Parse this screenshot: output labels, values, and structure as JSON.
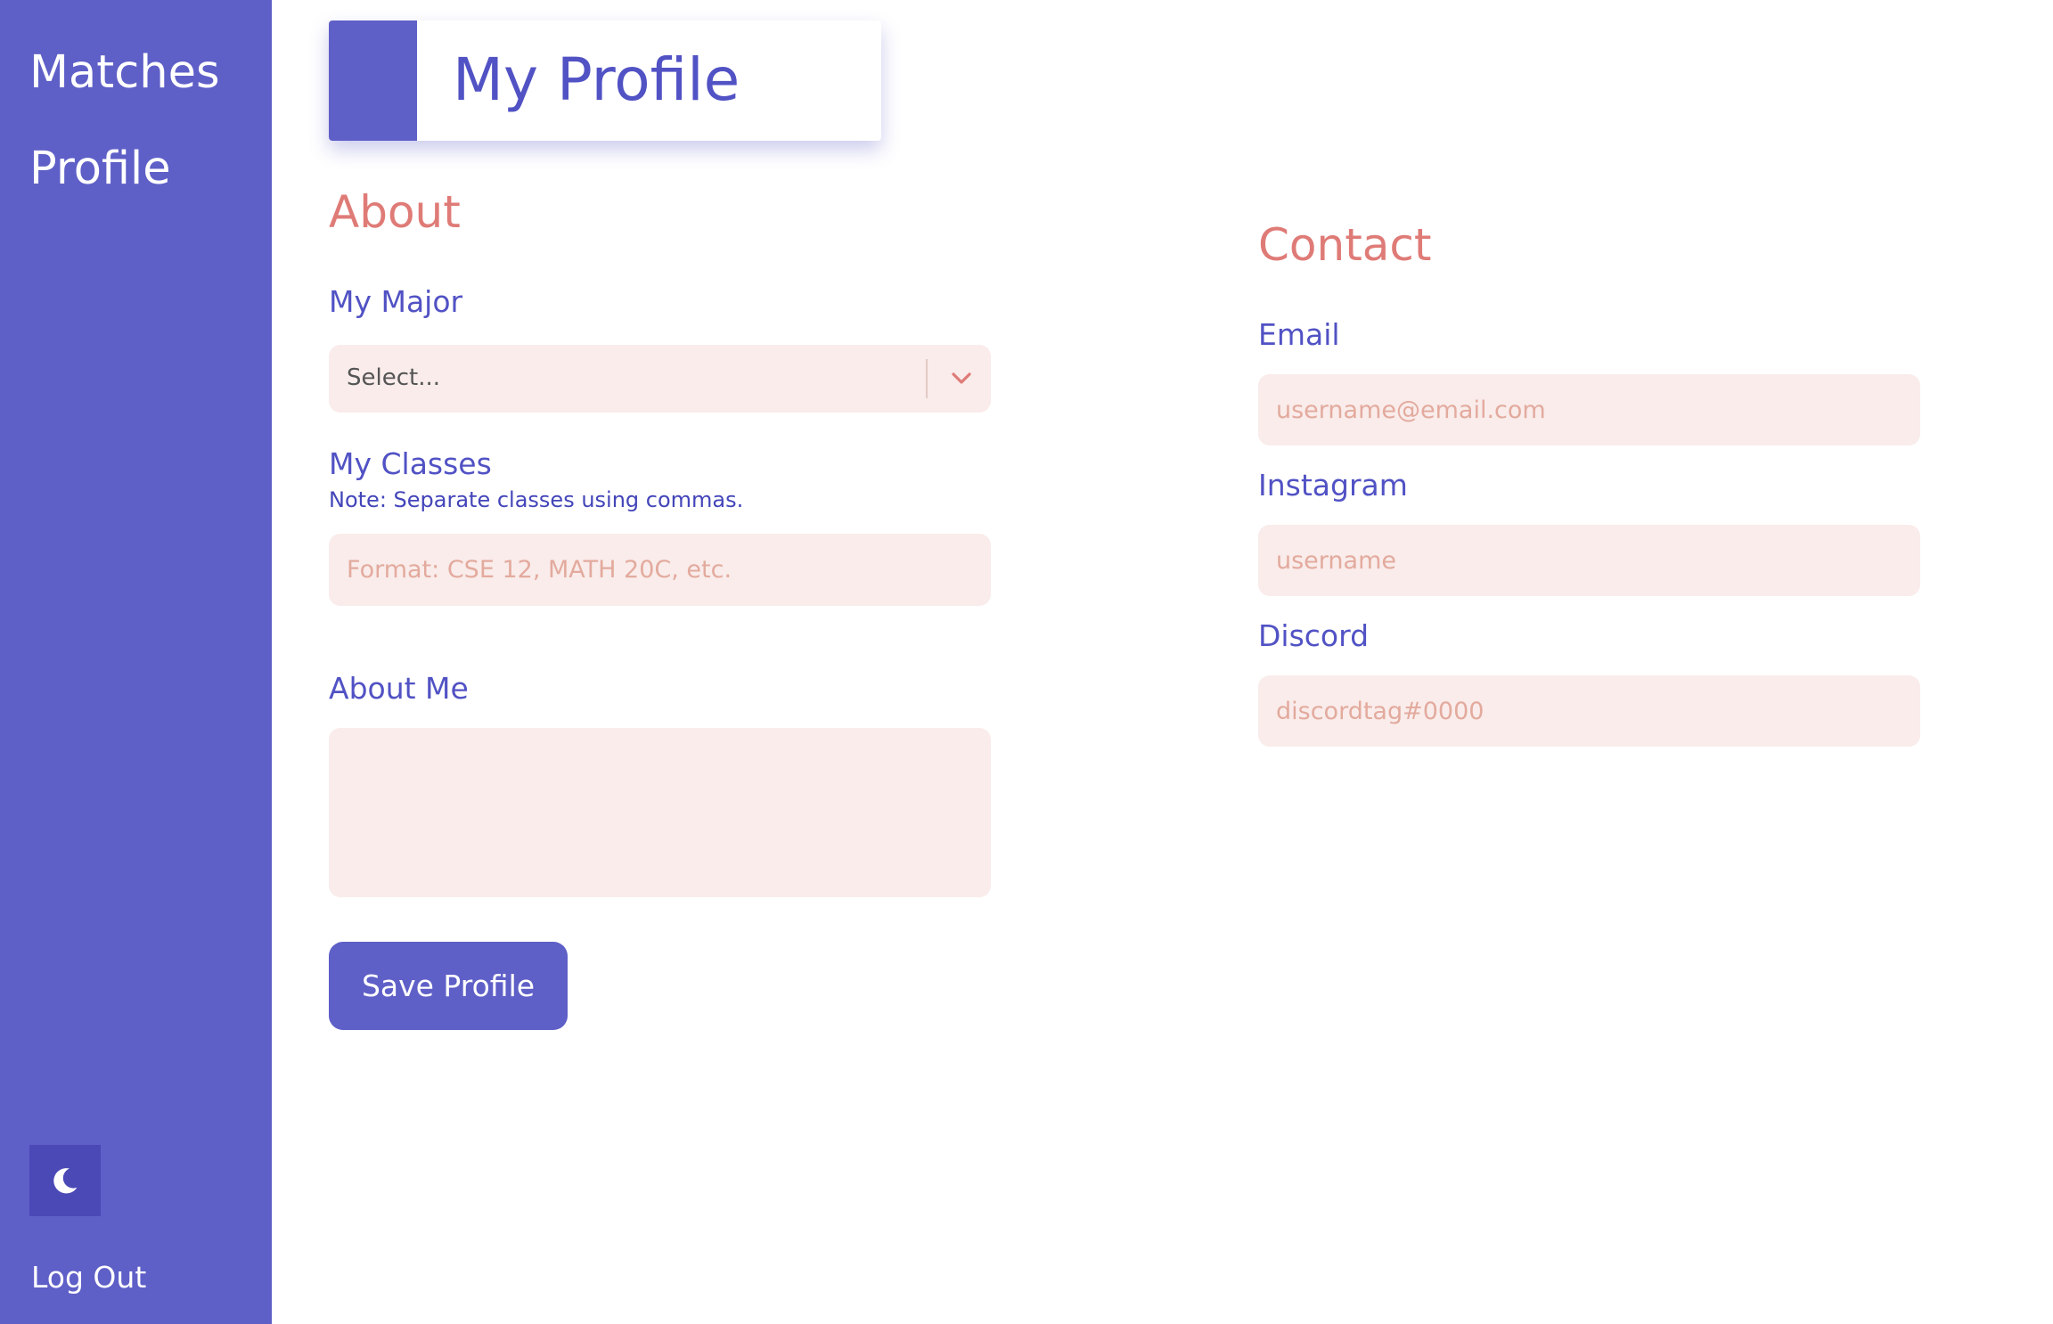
{
  "sidebar": {
    "links": [
      "Matches",
      "Profile"
    ],
    "theme_icon": "moon-icon",
    "logout_label": "Log Out"
  },
  "header": {
    "title": "My Profile"
  },
  "about": {
    "heading": "About",
    "major": {
      "label": "My Major",
      "selected": "Select...",
      "icon": "chevron-down-icon"
    },
    "classes": {
      "label": "My Classes",
      "note": "Note: Separate classes using commas.",
      "placeholder": "Format: CSE 12, MATH 20C, etc."
    },
    "about_me": {
      "label": "About Me",
      "value": ""
    },
    "save_label": "Save Profile"
  },
  "contact": {
    "heading": "Contact",
    "email": {
      "label": "Email",
      "placeholder": "username@email.com"
    },
    "instagram": {
      "label": "Instagram",
      "placeholder": "username"
    },
    "discord": {
      "label": "Discord",
      "placeholder": "discordtag#0000"
    }
  },
  "colors": {
    "primary": "#5f5fc8",
    "accent": "#df7b77",
    "field_bg": "#f9eceb",
    "placeholder": "#e3aa9d"
  }
}
